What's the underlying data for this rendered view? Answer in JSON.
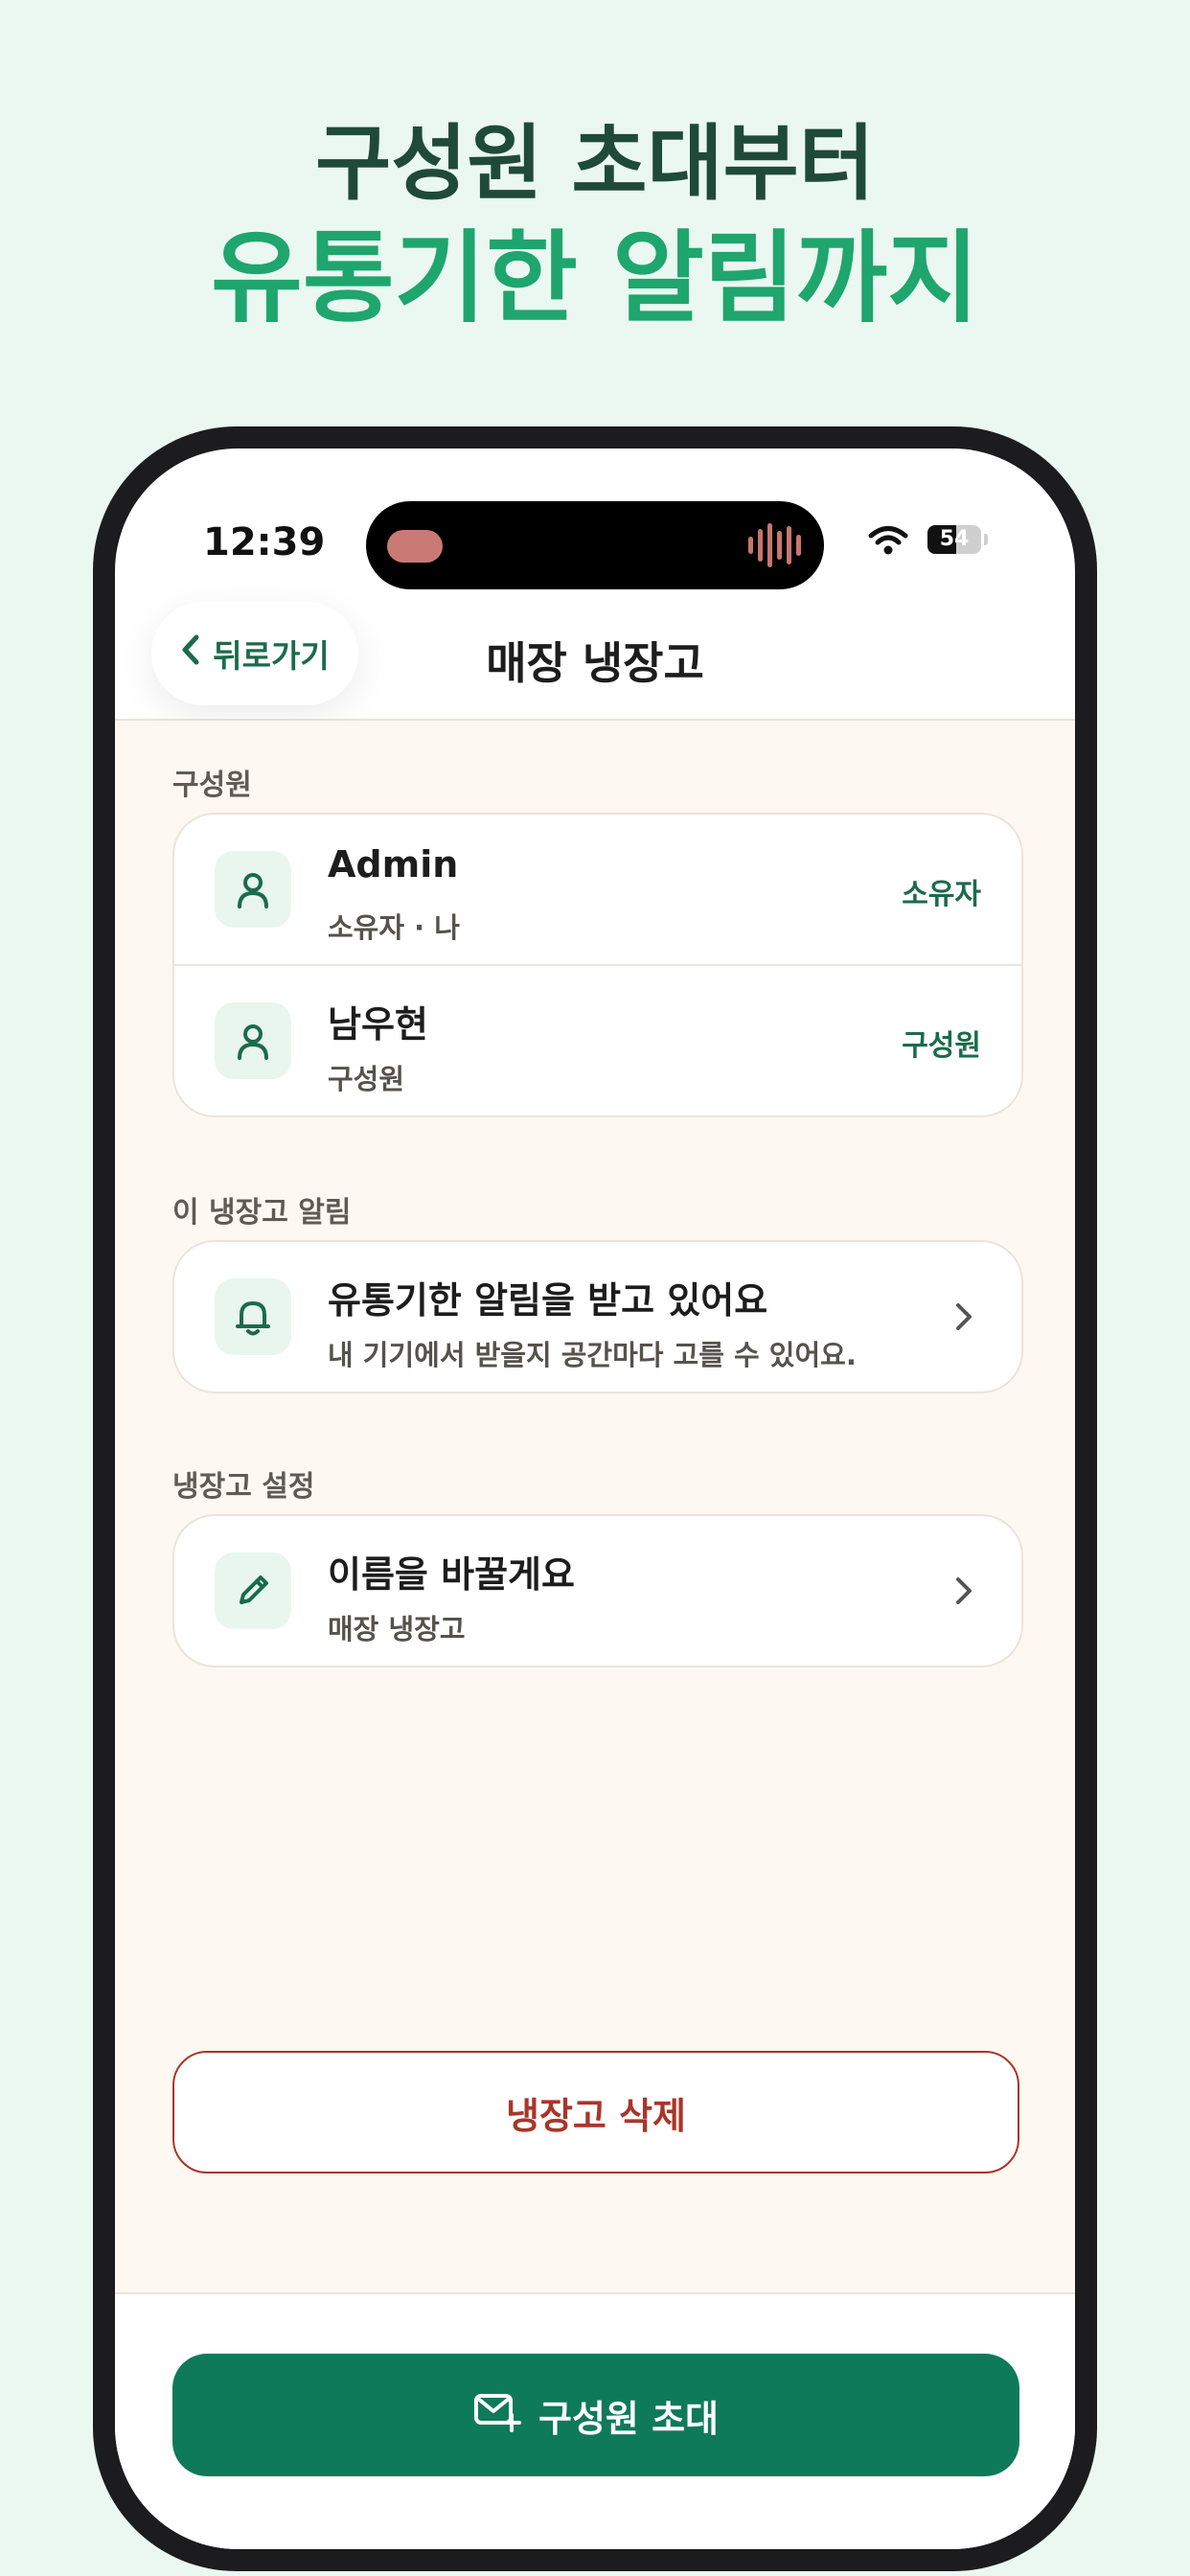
{
  "promo": {
    "line1": "구성원 초대부터",
    "line2": "유통기한 알림까지"
  },
  "status": {
    "time": "12:39",
    "battery": "54"
  },
  "navbar": {
    "back_label": "뒤로가기",
    "title": "매장 냉장고"
  },
  "members": {
    "section_label": "구성원",
    "items": [
      {
        "name": "Admin",
        "sub": "소유자 · 나",
        "role": "소유자",
        "icon": "person-icon"
      },
      {
        "name": "남우현",
        "sub": "구성원",
        "role": "구성원",
        "icon": "person-icon"
      }
    ]
  },
  "alerts": {
    "section_label": "이 냉장고 알림",
    "title": "유통기한 알림을 받고 있어요",
    "sub": "내 기기에서 받을지 공간마다 고를 수 있어요.",
    "icon": "bell-icon"
  },
  "settings": {
    "section_label": "냉장고 설정",
    "title": "이름을 바꿀게요",
    "sub": "매장 냉장고",
    "icon": "pencil-icon"
  },
  "delete_label": "냉장고 삭제",
  "invite_label": "구성원 초대",
  "colors": {
    "background": "#eaf8f1",
    "accent": "#1b6b4a",
    "primary_button": "#0f7a58",
    "danger": "#a8362a",
    "headline_dark": "#1f4a39",
    "headline_green": "#1fa56e"
  }
}
